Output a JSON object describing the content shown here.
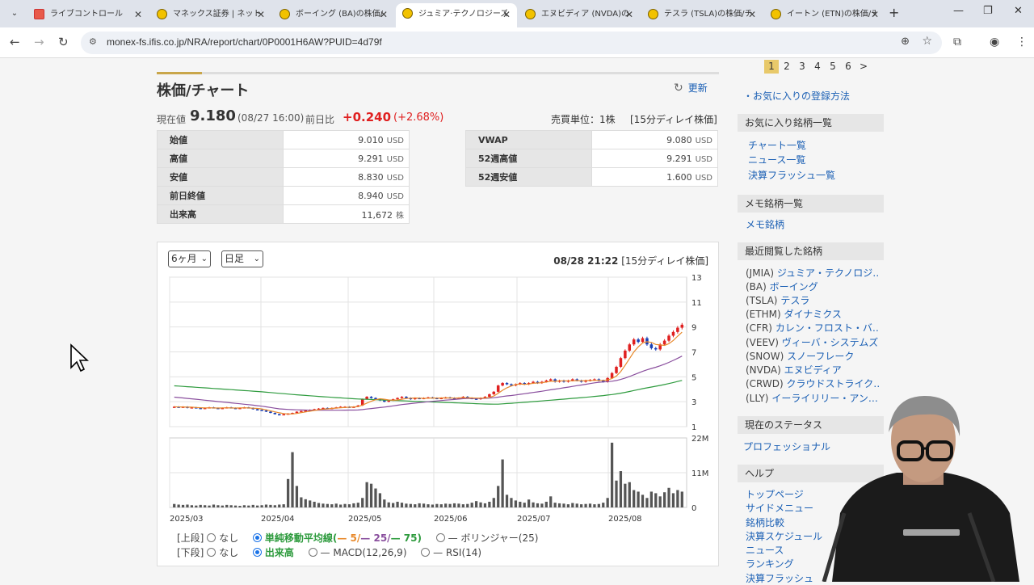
{
  "browser": {
    "tabs": [
      {
        "label": "ライブコントロール",
        "active": false
      },
      {
        "label": "マネックス証券 | ネット証",
        "active": false
      },
      {
        "label": "ボーイング (BA)の株価/",
        "active": false
      },
      {
        "label": "ジュミア·テクノロジーズ (",
        "active": true
      },
      {
        "label": "エヌビディア (NVDA)の株",
        "active": false
      },
      {
        "label": "テスラ (TSLA)の株価/チ",
        "active": false
      },
      {
        "label": "イートン (ETN)の株価/チ",
        "active": false
      }
    ],
    "url": "monex-fs.ifis.co.jp/NRA/report/chart/0P0001H6AW?PUID=4d79f"
  },
  "main": {
    "title": "株価/チャート",
    "refresh_label": "更新",
    "price_label": "現在値",
    "price": "9.180",
    "price_date": "(08/27 16:00)",
    "change_label": "前日比",
    "change": "+0.240",
    "change_pct": "(+2.68%)",
    "trade_unit": "売買単位：1株",
    "delay_note": "[15分ディレイ株価]",
    "quotes_left": [
      {
        "label": "始値",
        "value": "9.010",
        "unit": "USD"
      },
      {
        "label": "高値",
        "value": "9.291",
        "unit": "USD"
      },
      {
        "label": "安値",
        "value": "8.830",
        "unit": "USD"
      },
      {
        "label": "前日終値",
        "value": "8.940",
        "unit": "USD"
      },
      {
        "label": "出来高",
        "value": "11,672",
        "unit": "株"
      }
    ],
    "quotes_right": [
      {
        "label": "VWAP",
        "value": "9.080",
        "unit": "USD"
      },
      {
        "label": "52週高値",
        "value": "9.291",
        "unit": "USD"
      },
      {
        "label": "52週安値",
        "value": "1.600",
        "unit": "USD"
      }
    ]
  },
  "chart_panel": {
    "period_select": "6ヶ月",
    "interval_select": "日足",
    "timestamp": "08/28 21:22",
    "delay_note": "[15分ディレイ株価]",
    "upper_label": "[上段]",
    "lower_label": "[下段]",
    "upper_options": {
      "none": "なし",
      "sma": "単純移動平均線(",
      "sma5": "— 5/",
      "sma25": "— 25/",
      "sma75": "— 75)",
      "bollinger": "— ボリンジャー(25)"
    },
    "lower_options": {
      "none": "なし",
      "volume": "出来高",
      "macd": "— MACD(12,26,9)",
      "rsi": "— RSI(14)"
    }
  },
  "chart_data": [
    {
      "type": "candlestick",
      "title": "",
      "x_ticks": [
        "2025/03",
        "2025/04",
        "2025/05",
        "2025/06",
        "2025/07",
        "2025/08"
      ],
      "y_ticks": [
        1,
        3,
        5,
        7,
        9,
        11,
        13
      ],
      "ylim": [
        1,
        13
      ],
      "grid": true,
      "close_series": [
        2.6,
        2.55,
        2.6,
        2.5,
        2.55,
        2.5,
        2.45,
        2.5,
        2.55,
        2.5,
        2.45,
        2.5,
        2.55,
        2.5,
        2.45,
        2.5,
        2.55,
        2.5,
        2.4,
        2.35,
        2.3,
        2.2,
        2.1,
        2.0,
        1.95,
        2.0,
        2.05,
        2.1,
        2.2,
        2.25,
        2.3,
        2.35,
        2.4,
        2.45,
        2.5,
        2.45,
        2.5,
        2.55,
        2.6,
        2.6,
        2.55,
        2.6,
        2.7,
        3.2,
        3.4,
        3.3,
        3.2,
        3.1,
        3.0,
        3.1,
        3.2,
        3.3,
        3.4,
        3.3,
        3.2,
        3.3,
        3.25,
        3.3,
        3.35,
        3.3,
        3.25,
        3.3,
        3.35,
        3.3,
        3.25,
        3.3,
        3.4,
        3.3,
        3.25,
        3.2,
        3.3,
        3.4,
        3.6,
        3.8,
        4.3,
        4.5,
        4.4,
        4.3,
        4.4,
        4.5,
        4.4,
        4.5,
        4.6,
        4.5,
        4.6,
        4.7,
        4.8,
        4.6,
        4.7,
        4.6,
        4.7,
        4.8,
        4.7,
        4.6,
        4.7,
        4.75,
        4.8,
        4.7,
        4.6,
        4.9,
        5.3,
        5.8,
        6.5,
        7.1,
        7.6,
        8.0,
        7.8,
        8.1,
        7.6,
        7.3,
        7.2,
        7.6,
        7.9,
        8.3,
        8.6,
        8.94,
        9.18
      ],
      "sma5_end": 8.6,
      "sma25_end": 6.7,
      "sma75_end": 4.7
    },
    {
      "type": "bar",
      "title": "",
      "series_name": "出来高",
      "y_ticks": [
        "22M",
        "11M",
        "0"
      ],
      "ylim": [
        0,
        22
      ],
      "unit": "M",
      "values": [
        1.1,
        0.9,
        0.8,
        0.9,
        0.7,
        0.6,
        0.8,
        0.7,
        0.6,
        0.9,
        0.7,
        0.6,
        0.8,
        0.7,
        0.6,
        0.5,
        0.7,
        0.6,
        0.8,
        0.6,
        0.7,
        0.9,
        0.8,
        0.7,
        0.9,
        1.0,
        9.0,
        17.5,
        6.8,
        3.2,
        2.6,
        2.2,
        1.8,
        1.4,
        1.2,
        1.1,
        1.0,
        1.2,
        0.9,
        1.1,
        1.0,
        1.3,
        1.5,
        3.0,
        8.0,
        7.5,
        6.0,
        4.5,
        2.5,
        1.6,
        1.4,
        1.8,
        1.5,
        1.2,
        1.1,
        1.0,
        1.3,
        1.2,
        1.0,
        0.9,
        1.1,
        1.0,
        1.2,
        1.1,
        1.3,
        1.2,
        1.0,
        1.1,
        1.5,
        2.0,
        1.6,
        1.3,
        1.8,
        3.0,
        6.8,
        15.2,
        4.0,
        3.0,
        2.2,
        1.8,
        1.5,
        2.5,
        1.6,
        1.3,
        1.2,
        1.8,
        3.5,
        1.5,
        1.3,
        1.2,
        1.0,
        1.4,
        1.2,
        1.0,
        1.1,
        1.2,
        1.0,
        1.1,
        1.5,
        3.0,
        20.5,
        8.5,
        11.5,
        7.5,
        8.0,
        5.5,
        5.0,
        4.0,
        3.0,
        5.0,
        4.5,
        3.5,
        4.8,
        6.2,
        4.5,
        5.5,
        5.0
      ]
    }
  ],
  "sidebar": {
    "pager": [
      "1",
      "2",
      "3",
      "4",
      "5",
      "6",
      ">"
    ],
    "favorites_howto": "・お気に入りの登録方法",
    "fav_head": "お気に入り銘柄一覧",
    "fav_links": [
      "チャート一覧",
      "ニュース一覧",
      "決算フラッシュ一覧"
    ],
    "memo_head": "メモ銘柄一覧",
    "memo_link": "メモ銘柄",
    "recent_head": "最近閲覧した銘柄",
    "recent": [
      {
        "code": "(JMIA)",
        "name": "ジュミア・テクノロジ…"
      },
      {
        "code": "(BA)",
        "name": "ボーイング"
      },
      {
        "code": "(TSLA)",
        "name": "テスラ"
      },
      {
        "code": "(ETHM)",
        "name": "ダイナミクス"
      },
      {
        "code": "(CFR)",
        "name": "カレン・フロスト・バ…"
      },
      {
        "code": "(VEEV)",
        "name": "ヴィーバ・システムズ"
      },
      {
        "code": "(SNOW)",
        "name": "スノーフレーク"
      },
      {
        "code": "(NVDA)",
        "name": "エヌビディア"
      },
      {
        "code": "(CRWD)",
        "name": "クラウドストライク…"
      },
      {
        "code": "(LLY)",
        "name": "イーライリリー・アン…"
      }
    ],
    "status_head": "現在のステータス",
    "status_link": "プロフェッショナル",
    "help_head": "ヘルプ",
    "help_links": [
      "トップページ",
      "サイドメニュー",
      "銘柄比較",
      "決算スケジュール",
      "ニュース",
      "ランキング",
      "決算フラッシュ"
    ]
  },
  "colors": {
    "up": "#e02020",
    "down": "#1a3fb4",
    "sma5": "#e8892b",
    "sma25": "#8a4f9e",
    "sma75": "#2e9b3e",
    "accent": "#c9a64a",
    "link": "#1a5fb4"
  }
}
